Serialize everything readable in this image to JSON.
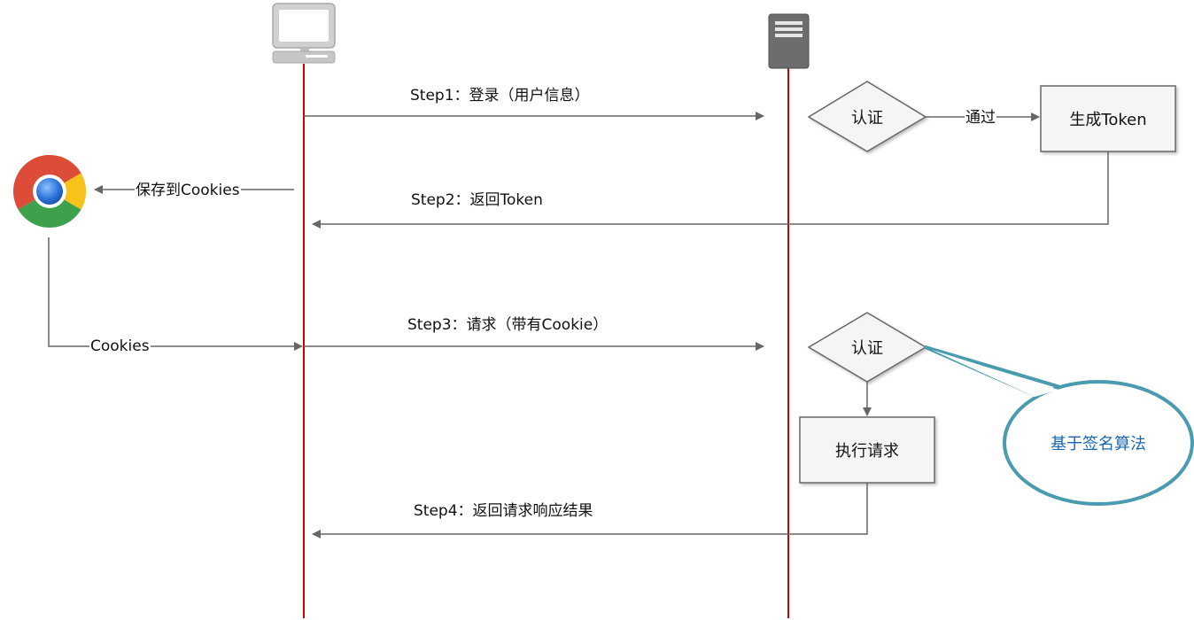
{
  "actors": {
    "client": {
      "icon": "computer-icon"
    },
    "server": {
      "icon": "server-icon"
    },
    "browser": {
      "icon": "chrome-icon"
    }
  },
  "messages": {
    "step1": "Step1：登录（用户信息）",
    "step2": "Step2：返回Token",
    "step3": "Step3：请求（带有Cookie）",
    "step4": "Step4：返回请求响应结果"
  },
  "nodes": {
    "auth1": "认证",
    "pass": "通过",
    "generate_token": "生成Token",
    "auth2": "认证",
    "execute": "执行请求"
  },
  "browser_labels": {
    "save_cookies": "保存到Cookies",
    "cookies": "Cookies"
  },
  "callout": {
    "text": "基于签名算法",
    "color": "#4a9bb0",
    "text_color": "#1a66b3"
  },
  "colors": {
    "lifeline": "#cc0000",
    "arrow": "#666666",
    "box_fill": "#f5f5f5"
  }
}
